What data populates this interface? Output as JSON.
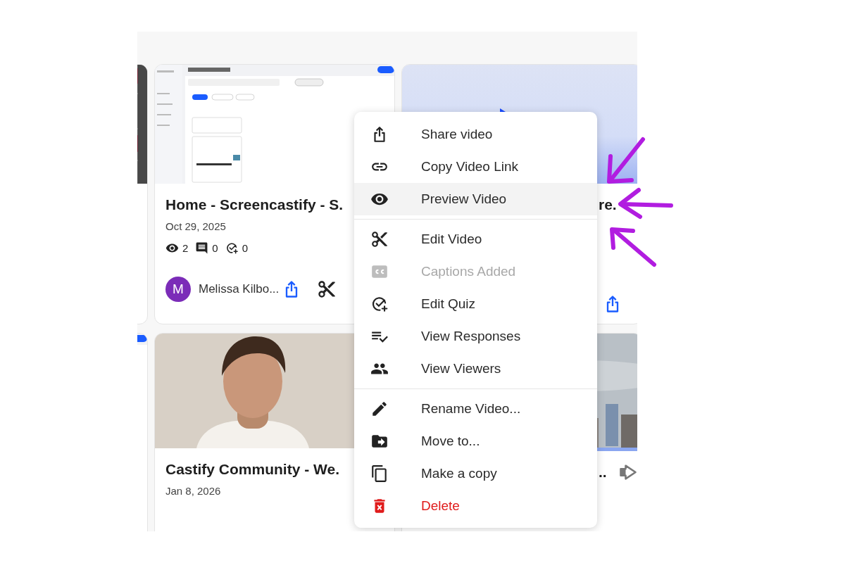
{
  "cards": [
    {
      "kind": "full",
      "title": "Home - Screencastify - S.",
      "date": "Oct 29, 2025",
      "stats": [
        {
          "kind": "views",
          "count": "2"
        },
        {
          "kind": "comments",
          "count": "0"
        },
        {
          "kind": "quiz",
          "count": "0"
        }
      ],
      "owner": {
        "initial": "M",
        "name": "Melissa Kilbo..."
      },
      "actions": [
        {
          "kind": "share"
        },
        {
          "kind": "edit"
        }
      ]
    },
    {
      "kind": "covered",
      "title": "re.",
      "actions": [
        {
          "kind": "share"
        }
      ]
    },
    {
      "kind": "full",
      "title": "Castify Community - We.",
      "date": "Jan 8, 2026"
    },
    {
      "kind": "covered",
      "title": "..",
      "actions": [
        {
          "kind": "forward"
        }
      ]
    }
  ],
  "menu": {
    "sections": [
      {
        "items": [
          {
            "kind": "share",
            "label": "Share video",
            "selected": false,
            "disabled": false,
            "danger": false
          },
          {
            "kind": "link",
            "label": "Copy Video Link",
            "selected": false,
            "disabled": false,
            "danger": false
          },
          {
            "kind": "eye",
            "label": "Preview Video",
            "selected": true,
            "disabled": false,
            "danger": false
          }
        ]
      },
      {
        "items": [
          {
            "kind": "scissors",
            "label": "Edit Video",
            "selected": false,
            "disabled": false,
            "danger": false
          },
          {
            "kind": "captions",
            "label": "Captions Added",
            "selected": false,
            "disabled": true,
            "danger": false
          },
          {
            "kind": "quiz",
            "label": "Edit Quiz",
            "selected": false,
            "disabled": false,
            "danger": false
          },
          {
            "kind": "list-check",
            "label": "View Responses",
            "selected": false,
            "disabled": false,
            "danger": false
          },
          {
            "kind": "people",
            "label": "View Viewers",
            "selected": false,
            "disabled": false,
            "danger": false
          }
        ]
      },
      {
        "items": [
          {
            "kind": "pencil",
            "label": "Rename Video...",
            "selected": false,
            "disabled": false,
            "danger": false
          },
          {
            "kind": "folder-move",
            "label": "Move to...",
            "selected": false,
            "disabled": false,
            "danger": false
          },
          {
            "kind": "copy",
            "label": "Make a copy",
            "selected": false,
            "disabled": false,
            "danger": false
          },
          {
            "kind": "trash",
            "label": "Delete",
            "selected": false,
            "disabled": false,
            "danger": true
          }
        ]
      }
    ]
  }
}
